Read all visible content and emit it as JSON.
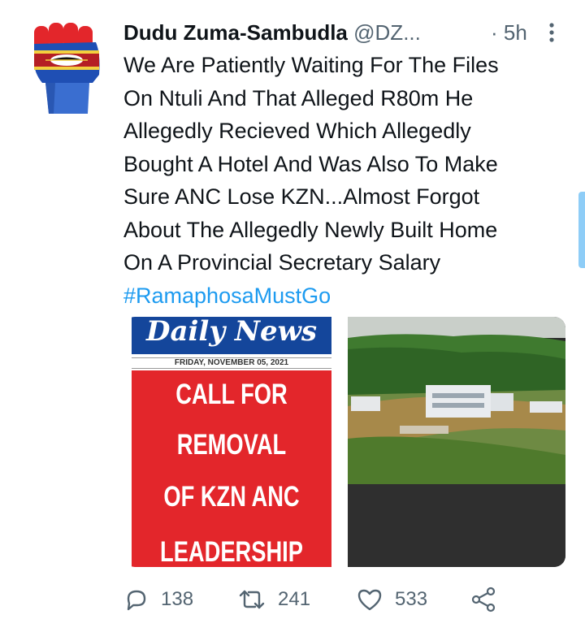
{
  "tweet": {
    "author": {
      "display_name": "Dudu Zuma-Sambudla",
      "handle": "@DZ...",
      "avatar": "raised-fist-eswatini-flag"
    },
    "separator": "·",
    "time": "5h",
    "text_lines": [
      "We Are Patiently Waiting For The Files",
      "On Ntuli And That Alleged R80m He",
      "Allegedly Recieved Which Allegedly",
      "Bought A Hotel And Was Also To Make",
      "Sure ANC Lose KZN...Almost Forgot",
      "About The Allegedly Newly Built Home",
      "On A Provincial Secretary Salary"
    ],
    "hashtag": "#RamaphosaMustGo",
    "media": {
      "newspaper": {
        "masthead": "Daily News",
        "date": "FRIDAY, NOVEMBER 05, 2021",
        "headline_lines": [
          "CALL FOR",
          "REMOVAL",
          "OF KZN ANC",
          "LEADERSHIP"
        ]
      },
      "photo": "hillside-mansion-photo"
    },
    "actions": {
      "replies": "138",
      "retweets": "241",
      "likes": "533"
    }
  },
  "colors": {
    "text": "#0f1419",
    "secondary": "#536471",
    "link": "#1d9bf0",
    "newspaper_blue": "#14469b",
    "newspaper_red": "#e3262b"
  }
}
